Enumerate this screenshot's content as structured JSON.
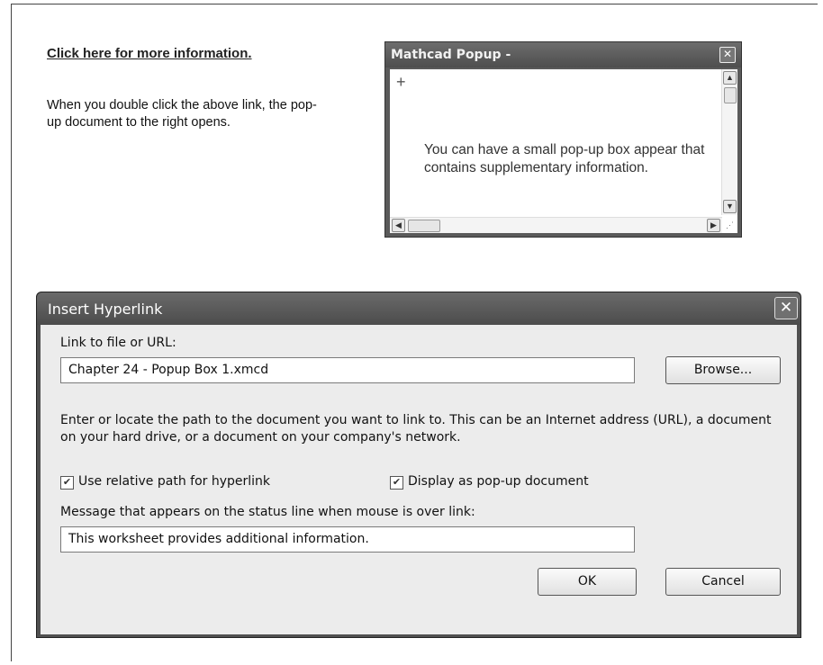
{
  "worksheet": {
    "link_text": "Click here for more information.",
    "description": "When you double click the above link, the pop-up document to the right opens."
  },
  "popup": {
    "title": "Mathcad Popup -",
    "cursor_symbol": "+",
    "body_text": "You can have a small pop-up box appear that contains supplementary information.",
    "close_icon": "close-icon",
    "up_arrow": "^",
    "down_arrow": "v",
    "left_arrow": "<",
    "right_arrow": ">"
  },
  "dialog": {
    "title": "Insert Hyperlink",
    "close_symbol": "✕",
    "link_label": "Link to file or URL:",
    "link_value": "Chapter 24 - Popup Box 1.xmcd",
    "browse_label": "Browse...",
    "help_text": "Enter or locate the path to the document you want to link to. This can be an Internet address (URL), a document on your hard drive, or a document on your company's network.",
    "relative_path_label": "Use relative path for hyperlink",
    "relative_path_checked": true,
    "popup_doc_label": "Display as pop-up document",
    "popup_doc_checked": true,
    "status_label": "Message that appears on the status line when mouse is over link:",
    "status_value": "This worksheet provides additional information.",
    "ok_label": "OK",
    "cancel_label": "Cancel"
  }
}
